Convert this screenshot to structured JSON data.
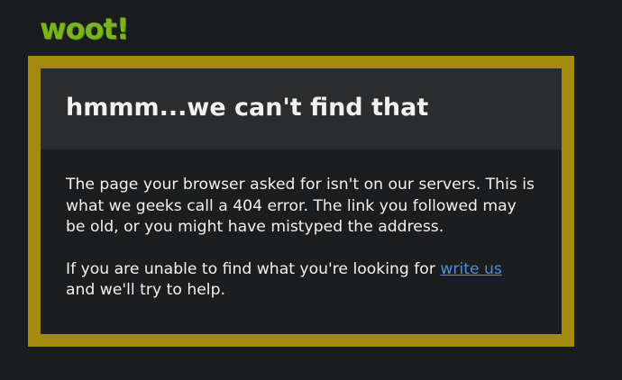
{
  "logo": {
    "text": "woot!",
    "color": "#7ab51d"
  },
  "error_box": {
    "frame_color": "#a48a0c",
    "title": "hmmm...we can't find that",
    "paragraph1": "The page your browser asked for isn't on our servers. This is what we geeks call a 404 error. The link you followed may be old, or you might have mistyped the address.",
    "paragraph2_before": "If you are unable to find what you're looking for ",
    "link_text": "write us",
    "paragraph2_after": " and we'll try to help."
  }
}
